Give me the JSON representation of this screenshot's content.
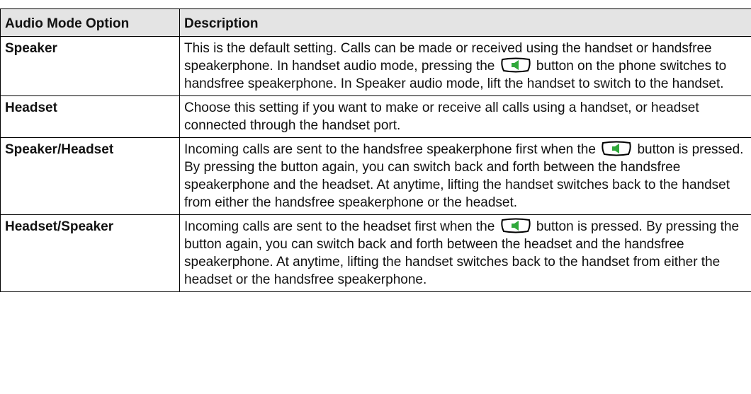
{
  "table": {
    "headers": {
      "option": "Audio Mode Option",
      "description": "Description"
    },
    "rows": [
      {
        "option": "Speaker",
        "description": {
          "before": "This is the default setting. Calls can be made or received using the handset or handsfree speakerphone. In handset audio mode, pressing the ",
          "after": " button on the phone switches to handsfree speakerphone. In Speaker audio mode, lift the handset to switch to the handset."
        }
      },
      {
        "option": "Headset",
        "description": {
          "text": "Choose this setting if you want to make or receive all calls using a handset, or headset connected through the handset port."
        }
      },
      {
        "option": "Speaker/Headset",
        "description": {
          "before": " Incoming calls are sent to the handsfree speakerphone first when the ",
          "after": " button is pressed. By pressing the button again, you can switch back and forth between the handsfree speakerphone and the headset. At anytime, lifting the handset switches back to the handset from either the handsfree speakerphone or the headset."
        }
      },
      {
        "option": "Headset/Speaker",
        "description": {
          "before": "Incoming calls are sent to the headset first when the ",
          "after": " button is pressed. By pressing the button again, you can switch back and forth between the headset and the handsfree speakerphone. At anytime, lifting the handset switches back to the handset from either the headset or the handsfree speakerphone."
        }
      }
    ]
  },
  "icons": {
    "speaker_button": "speaker-button-icon"
  },
  "colors": {
    "header_background": "#e4e4e4",
    "border": "#000000",
    "speaker_icon_green": "#2fa83a"
  }
}
